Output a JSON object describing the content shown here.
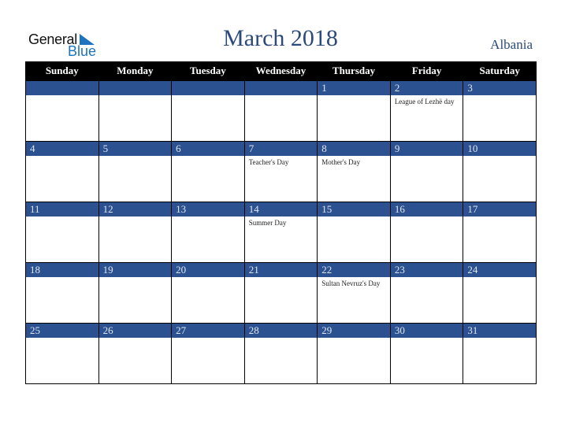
{
  "logo": {
    "general": "General",
    "blue": "Blue"
  },
  "title": "March 2018",
  "country": "Albania",
  "weekdays": [
    "Sunday",
    "Monday",
    "Tuesday",
    "Wednesday",
    "Thursday",
    "Friday",
    "Saturday"
  ],
  "weeks": [
    [
      {
        "d": "",
        "e": ""
      },
      {
        "d": "",
        "e": ""
      },
      {
        "d": "",
        "e": ""
      },
      {
        "d": "",
        "e": ""
      },
      {
        "d": "1",
        "e": ""
      },
      {
        "d": "2",
        "e": "League of Lezhë day"
      },
      {
        "d": "3",
        "e": ""
      }
    ],
    [
      {
        "d": "4",
        "e": ""
      },
      {
        "d": "5",
        "e": ""
      },
      {
        "d": "6",
        "e": ""
      },
      {
        "d": "7",
        "e": "Teacher's Day"
      },
      {
        "d": "8",
        "e": "Mother's Day"
      },
      {
        "d": "9",
        "e": ""
      },
      {
        "d": "10",
        "e": ""
      }
    ],
    [
      {
        "d": "11",
        "e": ""
      },
      {
        "d": "12",
        "e": ""
      },
      {
        "d": "13",
        "e": ""
      },
      {
        "d": "14",
        "e": "Summer Day"
      },
      {
        "d": "15",
        "e": ""
      },
      {
        "d": "16",
        "e": ""
      },
      {
        "d": "17",
        "e": ""
      }
    ],
    [
      {
        "d": "18",
        "e": ""
      },
      {
        "d": "19",
        "e": ""
      },
      {
        "d": "20",
        "e": ""
      },
      {
        "d": "21",
        "e": ""
      },
      {
        "d": "22",
        "e": "Sultan Nevruz's Day"
      },
      {
        "d": "23",
        "e": ""
      },
      {
        "d": "24",
        "e": ""
      }
    ],
    [
      {
        "d": "25",
        "e": ""
      },
      {
        "d": "26",
        "e": ""
      },
      {
        "d": "27",
        "e": ""
      },
      {
        "d": "28",
        "e": ""
      },
      {
        "d": "29",
        "e": ""
      },
      {
        "d": "30",
        "e": ""
      },
      {
        "d": "31",
        "e": ""
      }
    ]
  ],
  "colors": {
    "header_bg": "#000000",
    "day_band": "#2c5191",
    "title": "#2b4a7a",
    "logo_blue": "#1e73be"
  }
}
